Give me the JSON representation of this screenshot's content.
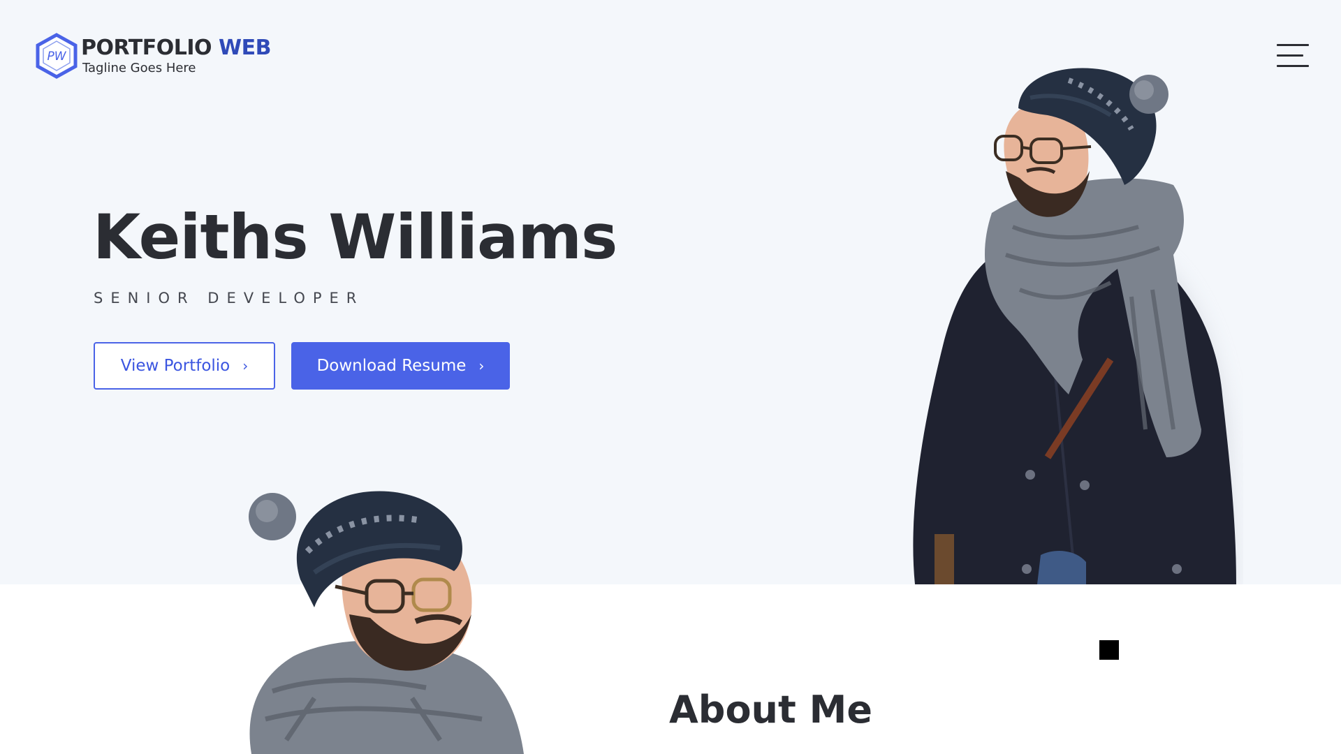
{
  "header": {
    "logo_badge": "PW",
    "brand_primary": "PORTFOLIO",
    "brand_accent": "WEB",
    "tagline": "Tagline Goes Here",
    "menu_icon": "hamburger-menu-icon"
  },
  "hero": {
    "name": "Keiths Williams",
    "role": "SENIOR DEVELOPER",
    "view_portfolio_label": "View Portfolio",
    "download_resume_label": "Download Resume",
    "chevron": "›"
  },
  "about": {
    "title": "About Me"
  },
  "colors": {
    "hero_background": "#f4f7fb",
    "accent_blue": "#4a63e7",
    "brand_blue": "#2f4ab8",
    "text_dark": "#2b2d33"
  }
}
